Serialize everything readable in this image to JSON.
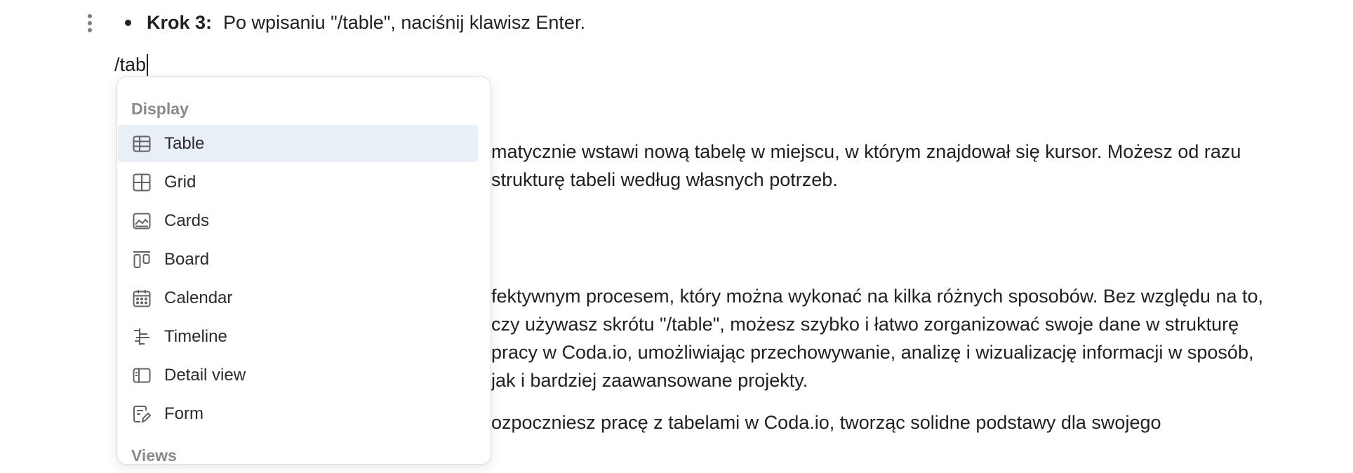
{
  "step": {
    "label": "Krok 3:",
    "text": "Po wpisaniu \"/table\", naciśnij klawisz Enter."
  },
  "editor": {
    "typed_text": "/tab"
  },
  "background_text": {
    "p1_line1": "matycznie wstawi nową tabelę w miejscu, w którym znajdował się kursor. Możesz od razu",
    "p1_line2": "strukturę tabeli według własnych potrzeb.",
    "p2_line1": "fektywnym procesem, który można wykonać na kilka różnych sposobów. Bez względu na to,",
    "p2_line2": "czy używasz skrótu \"/table\", możesz szybko i łatwo zorganizować swoje dane w strukturę",
    "p2_line3": "pracy w Coda.io, umożliwiając przechowywanie, analizę i wizualizację informacji w sposób,",
    "p2_line4": "jak i bardziej zaawansowane projekty.",
    "p3_line1": "ozpoczniesz pracę z tabelami w Coda.io, tworząc solidne podstawy dla swojego"
  },
  "menu": {
    "section_display": "Display",
    "section_views": "Views",
    "items": [
      {
        "label": "Table",
        "icon": "table-icon",
        "active": true
      },
      {
        "label": "Grid",
        "icon": "grid-icon"
      },
      {
        "label": "Cards",
        "icon": "cards-icon"
      },
      {
        "label": "Board",
        "icon": "board-icon"
      },
      {
        "label": "Calendar",
        "icon": "calendar-icon"
      },
      {
        "label": "Timeline",
        "icon": "timeline-icon"
      },
      {
        "label": "Detail view",
        "icon": "detail-view-icon"
      },
      {
        "label": "Form",
        "icon": "form-icon"
      }
    ]
  },
  "colors": {
    "active_item_bg": "#e9eff7",
    "section_header": "#8a8a8a",
    "icon": "#5f6368"
  }
}
